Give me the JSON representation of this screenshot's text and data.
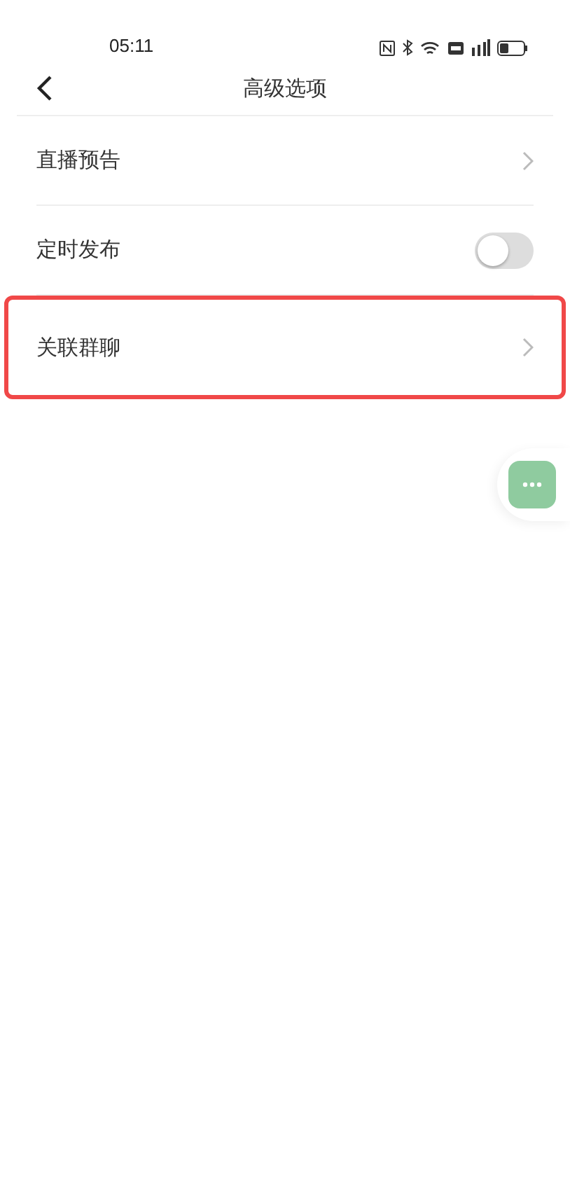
{
  "status_bar": {
    "time": "05:11"
  },
  "header": {
    "title": "高级选项"
  },
  "rows": [
    {
      "kind": "link",
      "label": "直播预告",
      "highlighted": false
    },
    {
      "kind": "toggle",
      "label": "定时发布",
      "on": false,
      "highlighted": false
    },
    {
      "kind": "link",
      "label": "关联群聊",
      "highlighted": true
    }
  ]
}
